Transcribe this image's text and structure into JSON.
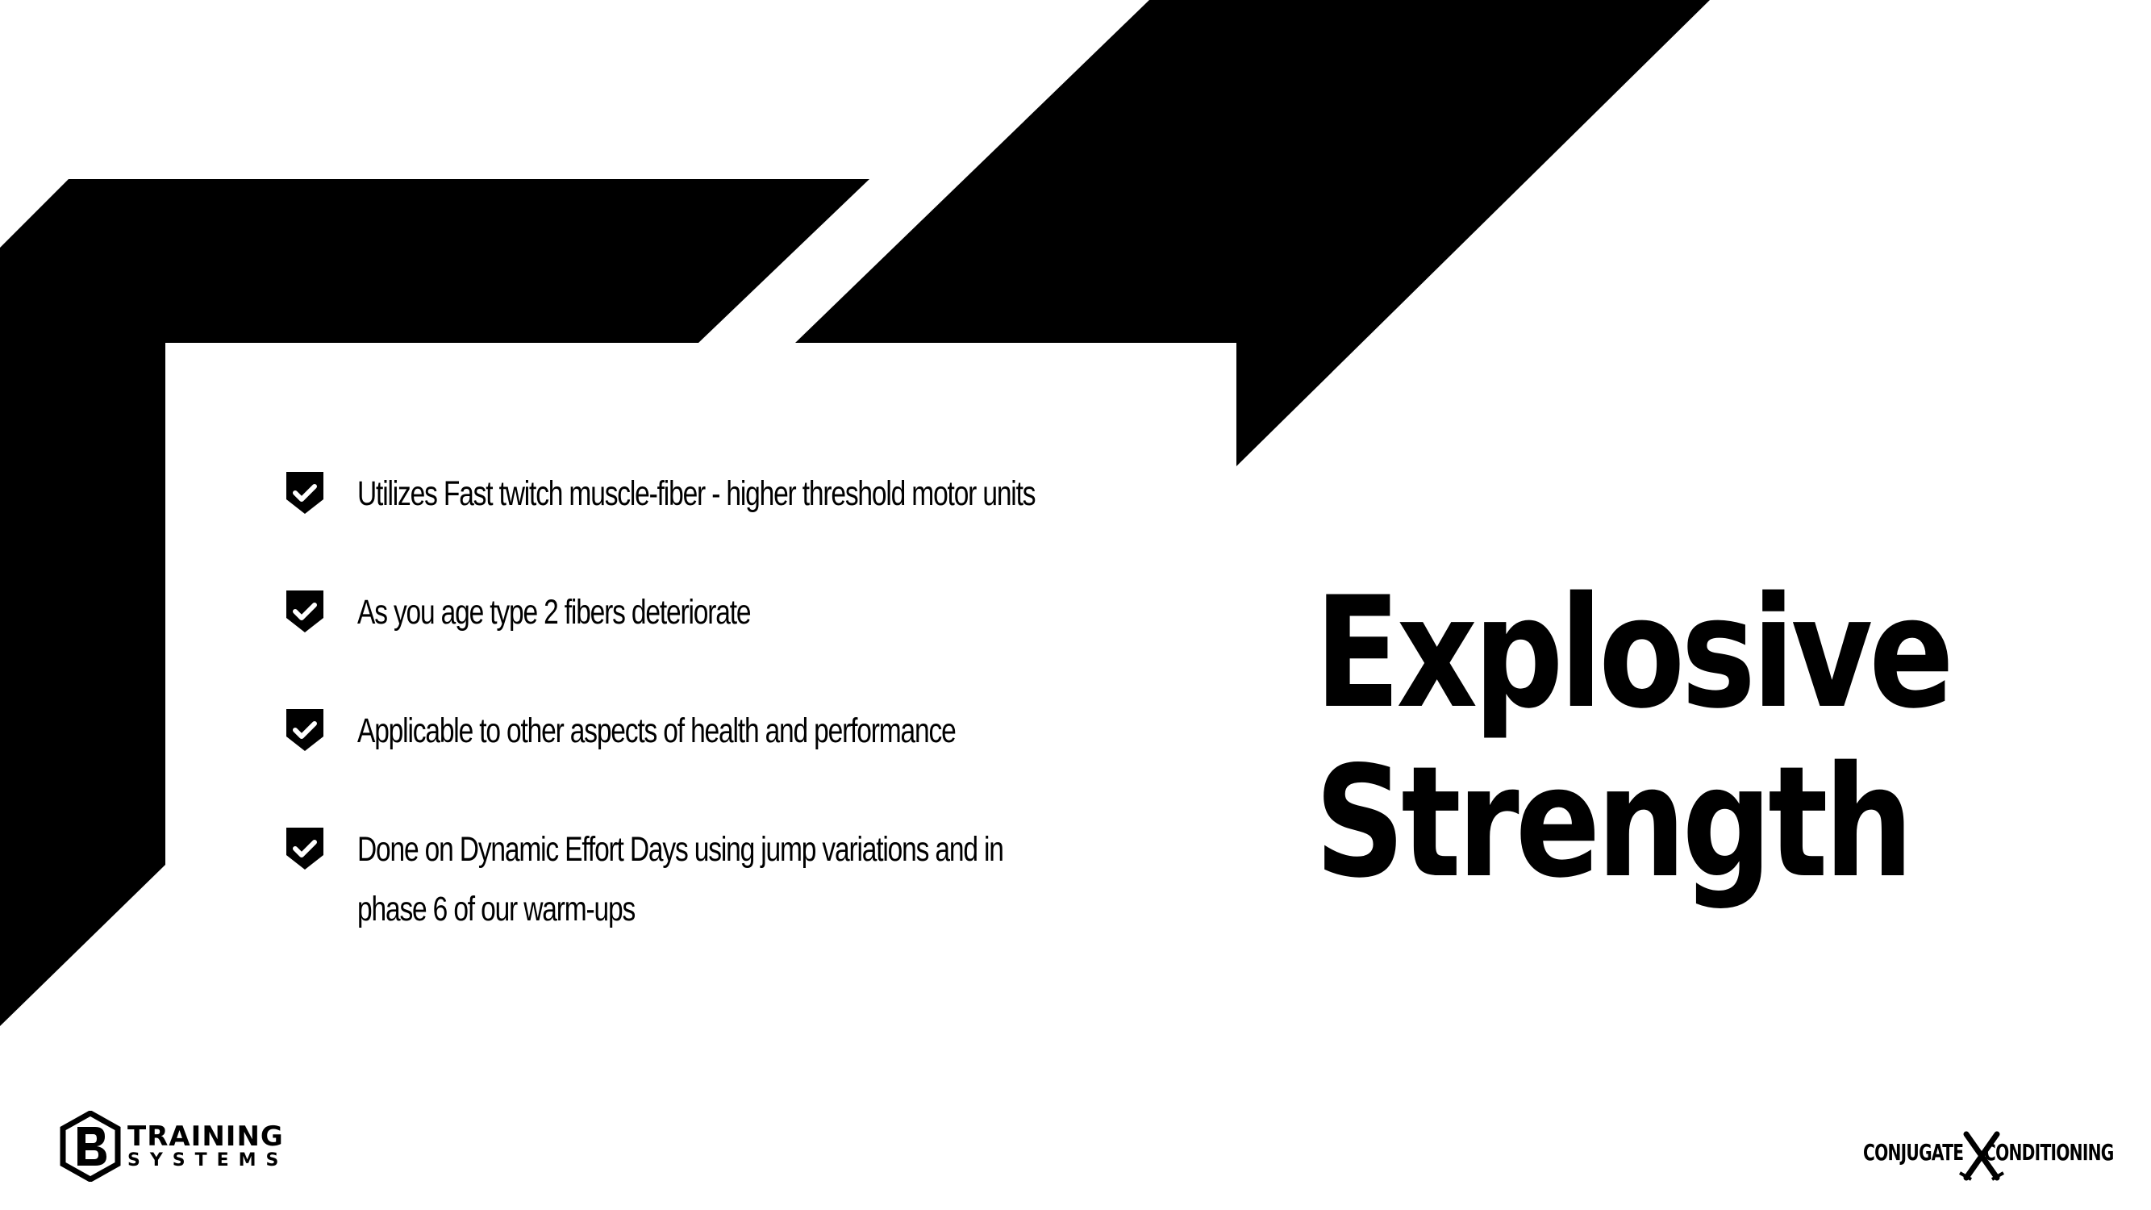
{
  "slide": {
    "title_line1": "Explosive",
    "title_line2": "Strength",
    "bullets": [
      "Utilizes Fast twitch muscle-fiber - higher threshold motor units",
      "As you age type 2 fibers deteriorate",
      "Applicable to other aspects of health and performance",
      "Done on Dynamic Effort Days using jump variations and in phase 6 of our warm-ups"
    ],
    "bullet_icon": "shield-check-icon"
  },
  "logos": {
    "left_line1": "TRAINING",
    "left_line2": "SYSTEMS",
    "left_icon": "pb-hexagon-logo-icon",
    "right_word1": "CONJUGATE",
    "right_word2": "CONDITIONING",
    "right_icon": "crossed-x-logo-icon"
  },
  "colors": {
    "background": "#ffffff",
    "foreground": "#000000"
  }
}
